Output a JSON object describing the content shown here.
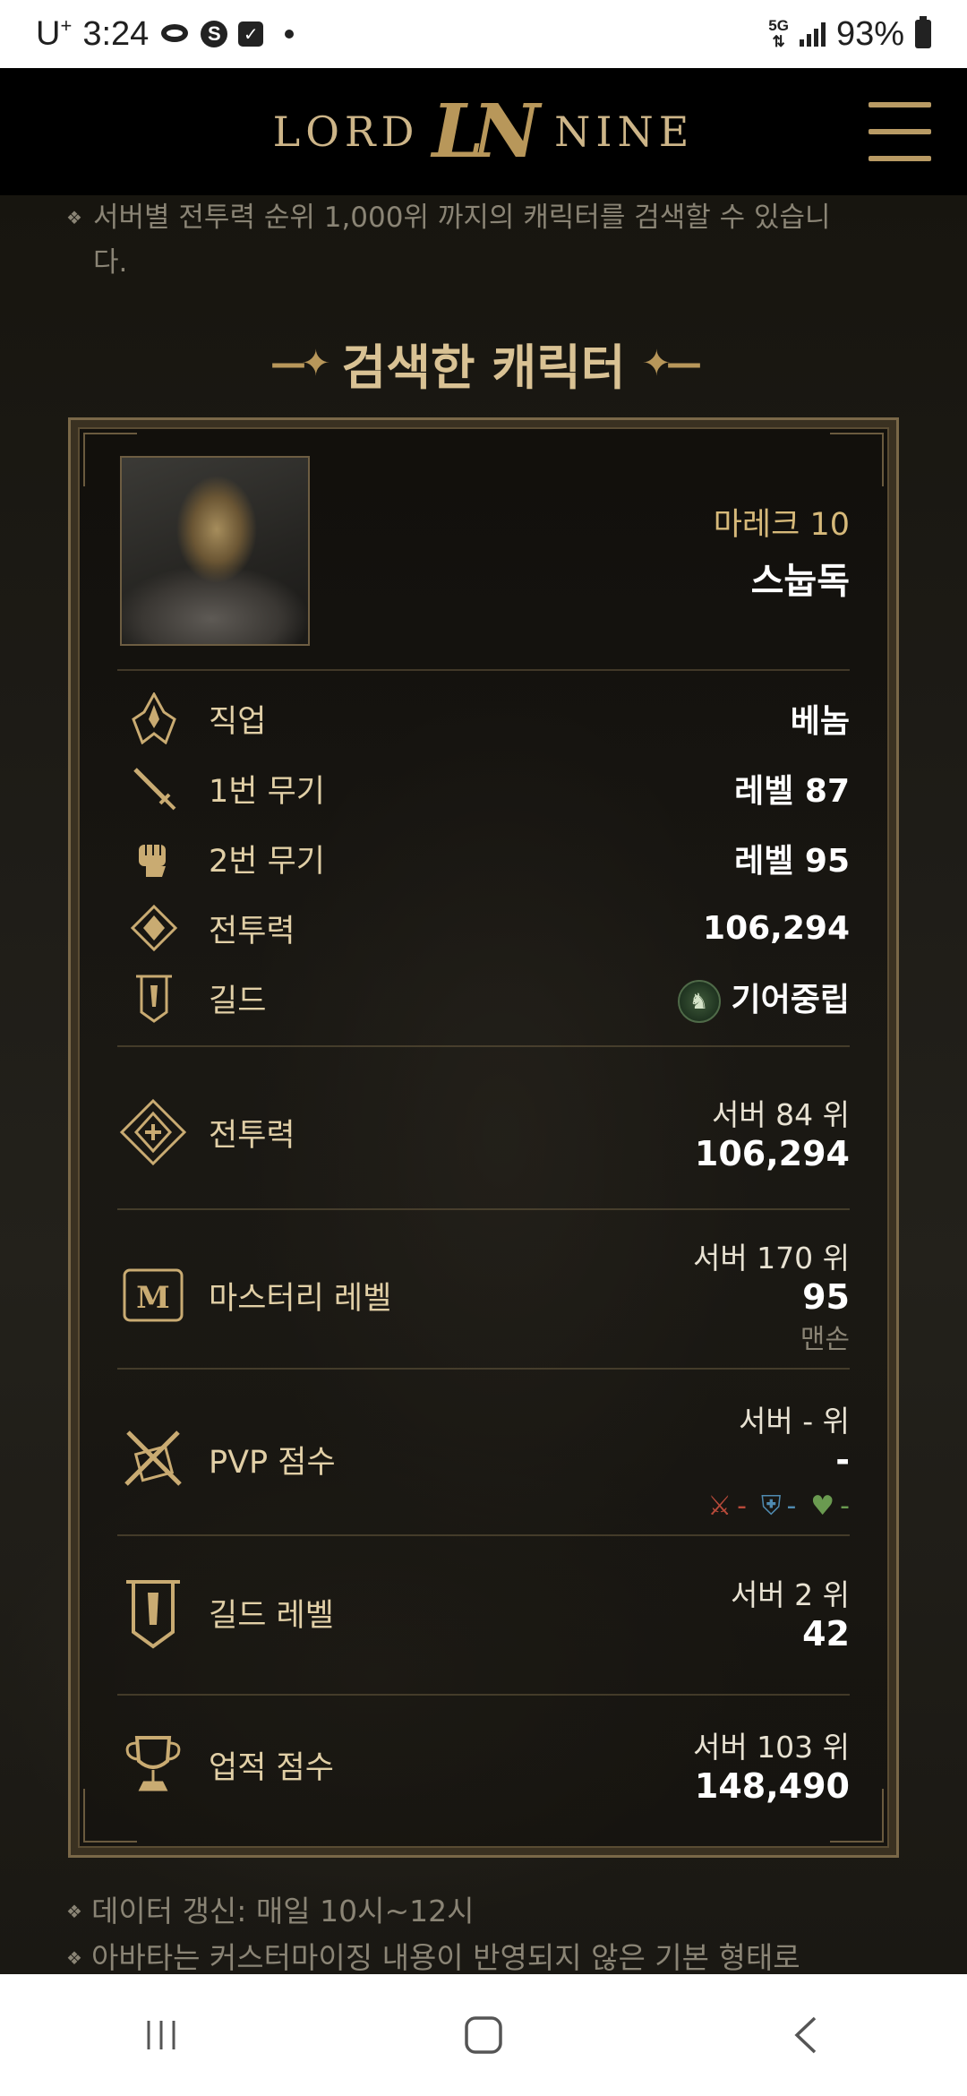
{
  "status_bar": {
    "carrier": "U",
    "carrier_sup": "+",
    "time": "3:24",
    "network": "5G",
    "battery": "93%"
  },
  "header": {
    "logo_left": "LORD",
    "logo_mark": "LN",
    "logo_right": "NINE"
  },
  "intro_note": "서버별 전투력 순위 1,000위 까지의 캐릭터를 검색할 수 있습니다.",
  "section_title": "검색한 캐릭터",
  "character": {
    "server": "마레크 10",
    "name": "스눕독"
  },
  "details": [
    {
      "icon": "class-icon",
      "label": "직업",
      "value": "베놈"
    },
    {
      "icon": "sword-icon",
      "label": "1번 무기",
      "value": "레벨 87"
    },
    {
      "icon": "fist-icon",
      "label": "2번 무기",
      "value": "레벨 95"
    },
    {
      "icon": "combat-power-icon",
      "label": "전투력",
      "value": "106,294"
    },
    {
      "icon": "guild-banner-icon",
      "label": "길드",
      "value": "기어중립"
    }
  ],
  "rankings": {
    "combat": {
      "label": "전투력",
      "rank": "서버 84 위",
      "value": "106,294"
    },
    "mastery": {
      "label": "마스터리 레벨",
      "rank": "서버 170 위",
      "value": "95",
      "sub": "맨손"
    },
    "pvp": {
      "label": "PVP 점수",
      "rank": "서버 - 위",
      "value": "-",
      "stats": [
        "-",
        "-",
        "-"
      ]
    },
    "guild_level": {
      "label": "길드 레벨",
      "rank": "서버 2 위",
      "value": "42"
    },
    "achievement": {
      "label": "업적 점수",
      "rank": "서버 103 위",
      "value": "148,490"
    }
  },
  "footer_notes": [
    "데이터 갱신: 매일 10시~12시",
    "아바타는 커스터마이징 내용이 반영되지 않은 기본 형태로"
  ],
  "colors": {
    "gold": "#d9c294",
    "label": "#e1cfa6",
    "background": "#15130f"
  }
}
